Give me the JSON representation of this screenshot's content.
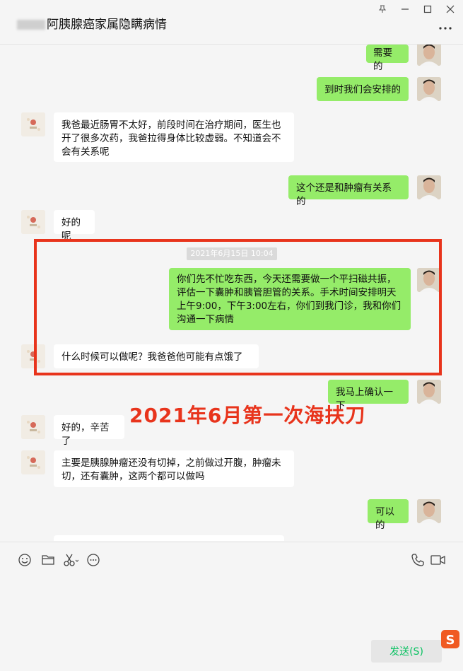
{
  "window": {
    "title": "阿胰腺癌家属隐瞒病情"
  },
  "messages": [
    {
      "side": "right",
      "text": "需要的"
    },
    {
      "side": "right",
      "text": "到时我们会安排的"
    },
    {
      "side": "left",
      "text": "我爸最近肠胃不太好，前段时间在治疗期间，医生也开了很多次药，我爸拉得身体比较虚弱。不知道会不会有关系呢"
    },
    {
      "side": "right",
      "text": "这个还是和肿瘤有关系的"
    },
    {
      "side": "left",
      "text": "好的呢"
    },
    {
      "side": "right",
      "text": "你们先不忙吃东西，今天还需要做一个平扫磁共振，评估一下囊肿和胰管胆管的关系。手术时间安排明天上午9:00，下午3:00左右，你们到我门诊，我和你们沟通一下病情"
    },
    {
      "side": "left",
      "text": "什么时候可以做呢？我爸爸他可能有点饿了"
    },
    {
      "side": "right",
      "text": "我马上确认一下"
    },
    {
      "side": "left",
      "text": "好的，辛苦了"
    },
    {
      "side": "left",
      "text": "主要是胰腺肿瘤还没有切掉，之前做过开腹，肿瘤未切，还有囊肿，这两个都可以做吗"
    },
    {
      "side": "right",
      "text": "可以的"
    }
  ],
  "timestamp": "2021年6月15日 10:04",
  "annotation": "2021年6月第一次海扶刀",
  "composer": {
    "send_label": "发送(S)"
  },
  "colors": {
    "self_bubble": "#95ec69",
    "other_bubble": "#ffffff",
    "highlight": "#e8341c",
    "send_text": "#07c160"
  }
}
